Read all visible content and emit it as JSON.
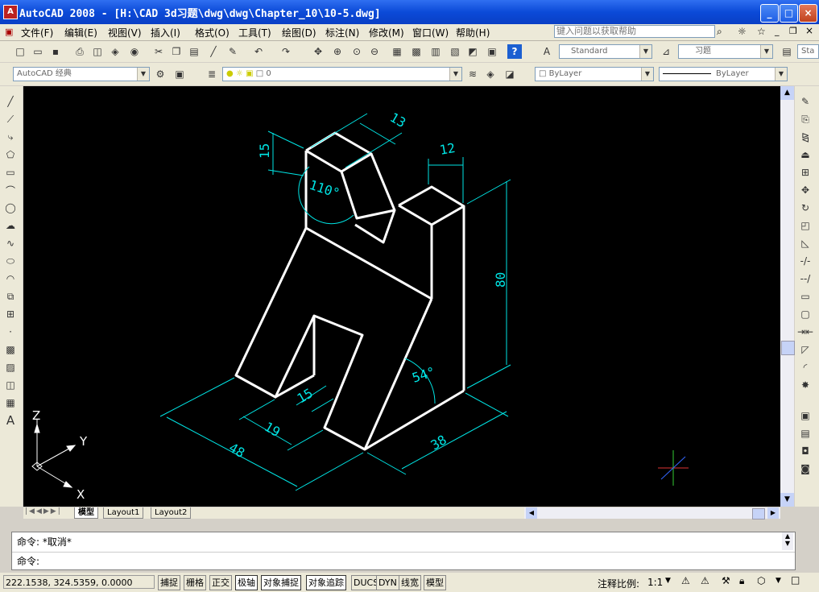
{
  "window": {
    "title": "AutoCAD 2008 - [H:\\CAD  3d习题\\dwg\\dwg\\Chapter_10\\10-5.dwg]"
  },
  "menu": [
    "文件(F)",
    "编辑(E)",
    "视图(V)",
    "插入(I)",
    "格式(O)",
    "工具(T)",
    "绘图(D)",
    "标注(N)",
    "修改(M)",
    "窗口(W)",
    "帮助(H)"
  ],
  "help_search": {
    "placeholder": "键入问题以获取帮助"
  },
  "toolbar": {
    "text_style": "Standard",
    "dim_style": "习题",
    "table_style": "Sta"
  },
  "layers": {
    "workspace": "AutoCAD 经典",
    "current_layer": "0",
    "color": "ByLayer",
    "linetype": "ByLayer"
  },
  "drawing": {
    "dims": {
      "d13": "13",
      "d12": "12",
      "d15a": "15",
      "d110": "110°",
      "d80": "80",
      "d54": "54°",
      "d15b": "15",
      "d19": "19",
      "d48": "48",
      "d38": "38"
    },
    "ucs": {
      "x": "X",
      "y": "Y",
      "z": "Z"
    }
  },
  "layout_tabs": [
    "模型",
    "Layout1",
    "Layout2"
  ],
  "command": {
    "line1": "命令: *取消*",
    "line2": "命令:"
  },
  "status": {
    "coords": "222.1538, 324.5359, 0.0000",
    "buttons": [
      "捕捉",
      "栅格",
      "正交",
      "极轴",
      "对象捕捉",
      "对象追踪",
      "DUCS",
      "DYN",
      "线宽",
      "模型"
    ],
    "annotation_scale_label": "注释比例:",
    "annotation_scale": "1:1"
  },
  "colors": {
    "titlebar": "#0b4ad8",
    "canvas": "#000000",
    "model_lines": "#ffffff",
    "dim_lines": "#00e5e5"
  }
}
